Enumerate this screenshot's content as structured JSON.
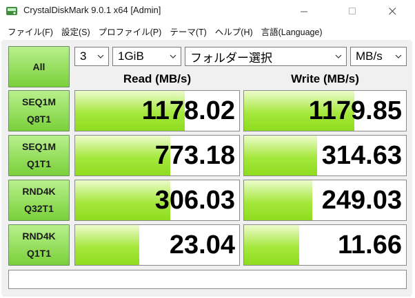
{
  "window": {
    "title": "CrystalDiskMark 9.0.1 x64 [Admin]"
  },
  "menu": [
    "ファイル(F)",
    "設定(S)",
    "プロファイル(P)",
    "テーマ(T)",
    "ヘルプ(H)",
    "言語(Language)"
  ],
  "controls": {
    "all_label": "All",
    "count": "3",
    "size": "1GiB",
    "drive": "フォルダー選択",
    "unit": "MB/s"
  },
  "columns": {
    "read": "Read (MB/s)",
    "write": "Write (MB/s)"
  },
  "tests": [
    {
      "line1": "SEQ1M",
      "line2": "Q8T1",
      "read": "1178.02",
      "write": "1179.85",
      "read_fill": 0.67,
      "write_fill": 0.68
    },
    {
      "line1": "SEQ1M",
      "line2": "Q1T1",
      "read": "773.18",
      "write": "314.63",
      "read_fill": 0.58,
      "write_fill": 0.45
    },
    {
      "line1": "RND4K",
      "line2": "Q32T1",
      "read": "306.03",
      "write": "249.03",
      "read_fill": 0.58,
      "write_fill": 0.42
    },
    {
      "line1": "RND4K",
      "line2": "Q1T1",
      "read": "23.04",
      "write": "11.66",
      "read_fill": 0.39,
      "write_fill": 0.34
    }
  ],
  "comment": "",
  "colors": {
    "button_green": "#7ad03a",
    "bar_green": "#a6e83e"
  }
}
